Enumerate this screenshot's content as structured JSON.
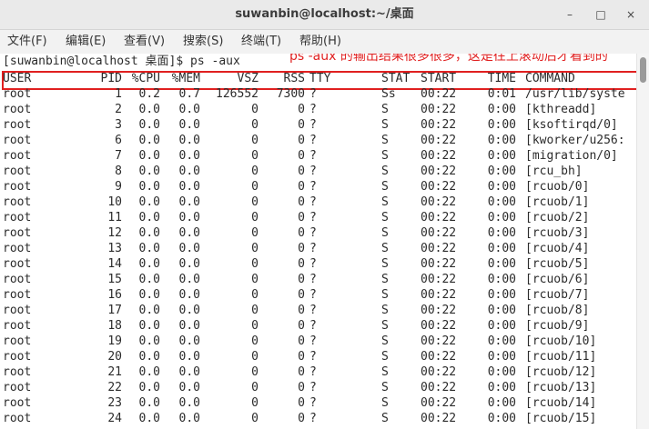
{
  "window": {
    "title": "suwanbin@localhost:~/桌面",
    "minimize_glyph": "–",
    "maximize_glyph": "□",
    "close_glyph": "×"
  },
  "menubar": {
    "items": [
      "文件(F)",
      "编辑(E)",
      "查看(V)",
      "搜索(S)",
      "终端(T)",
      "帮助(H)"
    ]
  },
  "terminal": {
    "prompt": "[suwanbin@localhost 桌面]$ ps -aux",
    "annotation": "ps -aux 的输出结果很多很多，这是往上滚动后才看到的",
    "annotation_color": "#e02020",
    "columns": [
      "USER",
      "PID",
      "%CPU",
      "%MEM",
      "VSZ",
      "RSS",
      "TTY",
      "STAT",
      "START",
      "TIME",
      "COMMAND"
    ],
    "rows": [
      [
        "root",
        "1",
        "0.2",
        "0.7",
        "126552",
        "7300",
        "?",
        "Ss",
        "00:22",
        "0:01",
        "/usr/lib/syste"
      ],
      [
        "root",
        "2",
        "0.0",
        "0.0",
        "0",
        "0",
        "?",
        "S",
        "00:22",
        "0:00",
        "[kthreadd]"
      ],
      [
        "root",
        "3",
        "0.0",
        "0.0",
        "0",
        "0",
        "?",
        "S",
        "00:22",
        "0:00",
        "[ksoftirqd/0]"
      ],
      [
        "root",
        "6",
        "0.0",
        "0.0",
        "0",
        "0",
        "?",
        "S",
        "00:22",
        "0:00",
        "[kworker/u256:"
      ],
      [
        "root",
        "7",
        "0.0",
        "0.0",
        "0",
        "0",
        "?",
        "S",
        "00:22",
        "0:00",
        "[migration/0]"
      ],
      [
        "root",
        "8",
        "0.0",
        "0.0",
        "0",
        "0",
        "?",
        "S",
        "00:22",
        "0:00",
        "[rcu_bh]"
      ],
      [
        "root",
        "9",
        "0.0",
        "0.0",
        "0",
        "0",
        "?",
        "S",
        "00:22",
        "0:00",
        "[rcuob/0]"
      ],
      [
        "root",
        "10",
        "0.0",
        "0.0",
        "0",
        "0",
        "?",
        "S",
        "00:22",
        "0:00",
        "[rcuob/1]"
      ],
      [
        "root",
        "11",
        "0.0",
        "0.0",
        "0",
        "0",
        "?",
        "S",
        "00:22",
        "0:00",
        "[rcuob/2]"
      ],
      [
        "root",
        "12",
        "0.0",
        "0.0",
        "0",
        "0",
        "?",
        "S",
        "00:22",
        "0:00",
        "[rcuob/3]"
      ],
      [
        "root",
        "13",
        "0.0",
        "0.0",
        "0",
        "0",
        "?",
        "S",
        "00:22",
        "0:00",
        "[rcuob/4]"
      ],
      [
        "root",
        "14",
        "0.0",
        "0.0",
        "0",
        "0",
        "?",
        "S",
        "00:22",
        "0:00",
        "[rcuob/5]"
      ],
      [
        "root",
        "15",
        "0.0",
        "0.0",
        "0",
        "0",
        "?",
        "S",
        "00:22",
        "0:00",
        "[rcuob/6]"
      ],
      [
        "root",
        "16",
        "0.0",
        "0.0",
        "0",
        "0",
        "?",
        "S",
        "00:22",
        "0:00",
        "[rcuob/7]"
      ],
      [
        "root",
        "17",
        "0.0",
        "0.0",
        "0",
        "0",
        "?",
        "S",
        "00:22",
        "0:00",
        "[rcuob/8]"
      ],
      [
        "root",
        "18",
        "0.0",
        "0.0",
        "0",
        "0",
        "?",
        "S",
        "00:22",
        "0:00",
        "[rcuob/9]"
      ],
      [
        "root",
        "19",
        "0.0",
        "0.0",
        "0",
        "0",
        "?",
        "S",
        "00:22",
        "0:00",
        "[rcuob/10]"
      ],
      [
        "root",
        "20",
        "0.0",
        "0.0",
        "0",
        "0",
        "?",
        "S",
        "00:22",
        "0:00",
        "[rcuob/11]"
      ],
      [
        "root",
        "21",
        "0.0",
        "0.0",
        "0",
        "0",
        "?",
        "S",
        "00:22",
        "0:00",
        "[rcuob/12]"
      ],
      [
        "root",
        "22",
        "0.0",
        "0.0",
        "0",
        "0",
        "?",
        "S",
        "00:22",
        "0:00",
        "[rcuob/13]"
      ],
      [
        "root",
        "23",
        "0.0",
        "0.0",
        "0",
        "0",
        "?",
        "S",
        "00:22",
        "0:00",
        "[rcuob/14]"
      ],
      [
        "root",
        "24",
        "0.0",
        "0.0",
        "0",
        "0",
        "?",
        "S",
        "00:22",
        "0:00",
        "[rcuob/15]"
      ]
    ]
  }
}
